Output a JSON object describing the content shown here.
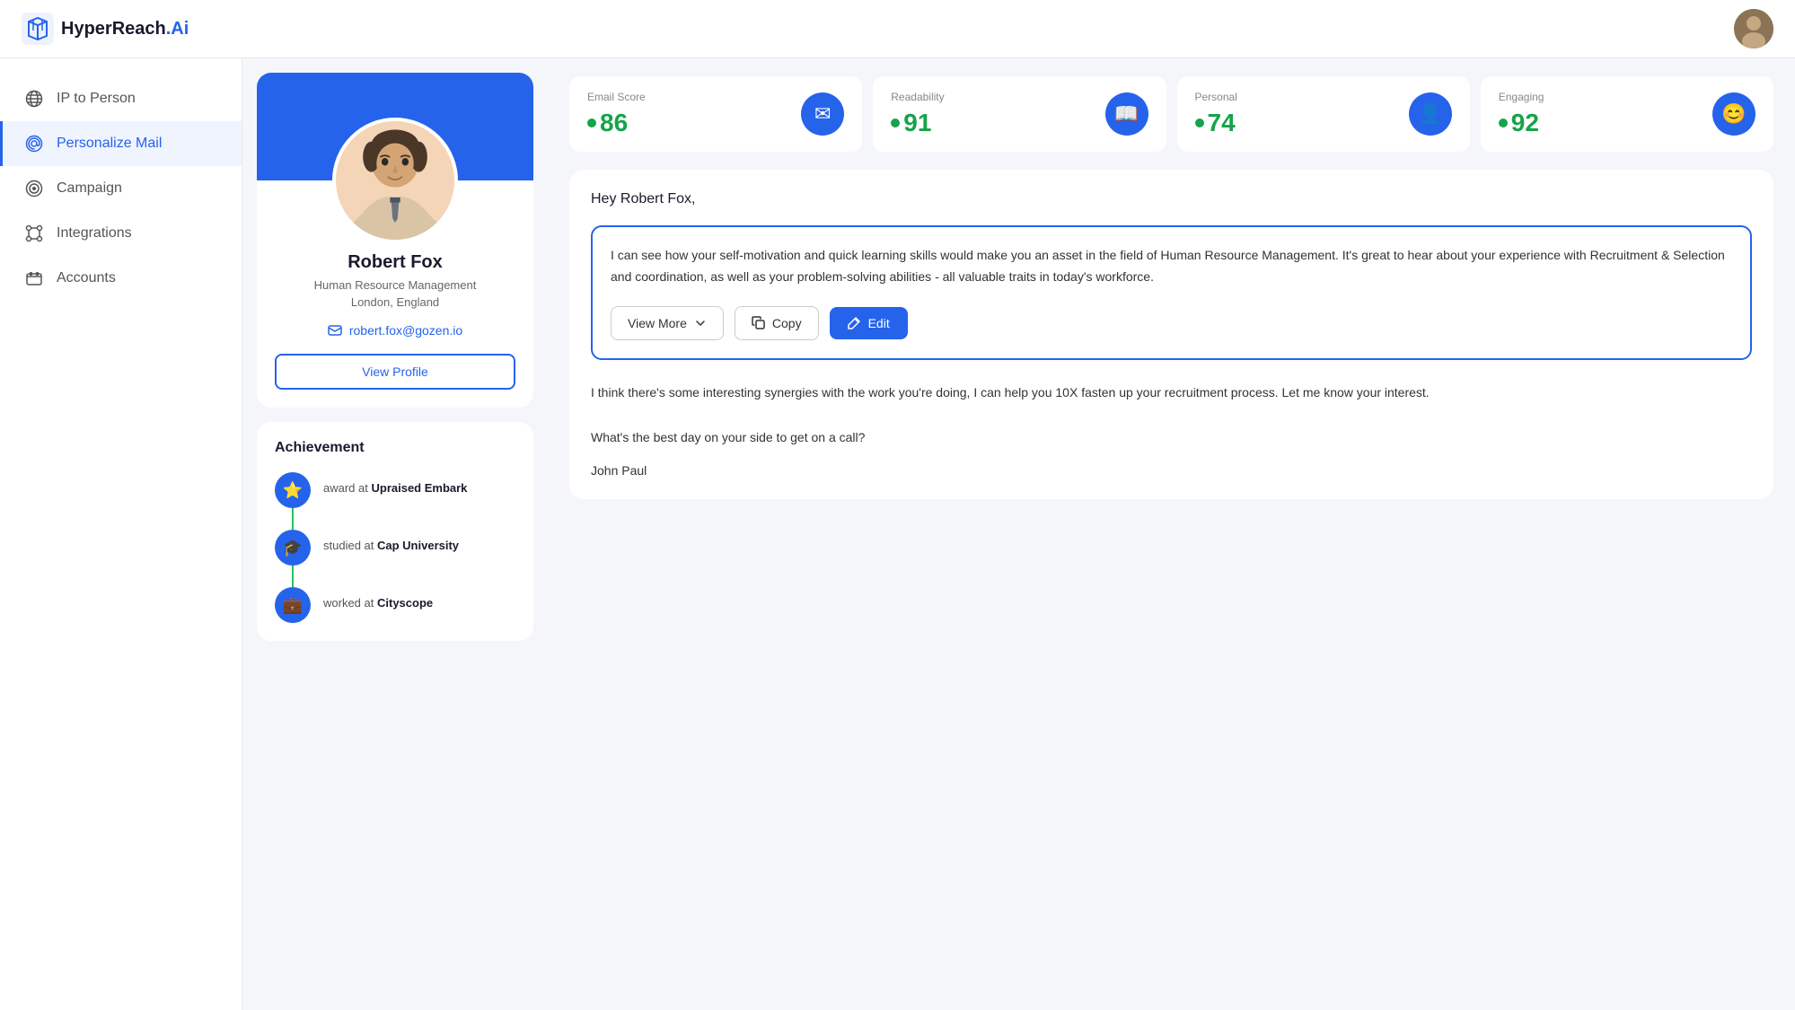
{
  "header": {
    "logo_text_hyper": "HyperReach",
    "logo_text_dot": ".",
    "logo_text_ai": "Ai"
  },
  "sidebar": {
    "items": [
      {
        "id": "ip-to-person",
        "label": "IP to Person",
        "icon": "globe"
      },
      {
        "id": "personalize-mail",
        "label": "Personalize Mail",
        "icon": "at",
        "active": true
      },
      {
        "id": "campaign",
        "label": "Campaign",
        "icon": "target"
      },
      {
        "id": "integrations",
        "label": "Integrations",
        "icon": "link"
      },
      {
        "id": "accounts",
        "label": "Accounts",
        "icon": "inbox"
      }
    ]
  },
  "profile": {
    "name": "Robert Fox",
    "title": "Human Resource Management",
    "location": "London, England",
    "email": "robert.fox@gozen.io",
    "view_profile_label": "View Profile"
  },
  "achievement": {
    "title": "Achievement",
    "items": [
      {
        "type": "award",
        "prefix": "award at",
        "place": "Upraised Embark",
        "icon": "⭐"
      },
      {
        "type": "education",
        "prefix": "studied at",
        "place": "Cap University",
        "icon": "🎓"
      },
      {
        "type": "work",
        "prefix": "worked at",
        "place": "Cityscope",
        "icon": "💼"
      }
    ]
  },
  "scores": [
    {
      "label": "Email Score",
      "value": "86",
      "icon": "✉"
    },
    {
      "label": "Readability",
      "value": "91",
      "icon": "📖"
    },
    {
      "label": "Personal",
      "value": "74",
      "icon": "👤"
    },
    {
      "label": "Engaging",
      "value": "92",
      "icon": "😊"
    }
  ],
  "email": {
    "greeting": "Hey Robert Fox,",
    "main_block": "I can see how your self-motivation and quick learning skills would make you an asset in the field of Human Resource Management. It's great to hear about your experience with Recruitment & Selection and coordination, as well as your problem-solving abilities - all valuable traits in today's workforce.",
    "body": "I think there's some interesting synergies with the work you're doing, I can help you 10X fasten up your recruitment process. Let me know your interest.\n\nWhat's the best day on your side to get on a call?",
    "signature": "John Paul",
    "actions": {
      "view_more": "View More",
      "copy": "Copy",
      "edit": "Edit"
    }
  }
}
